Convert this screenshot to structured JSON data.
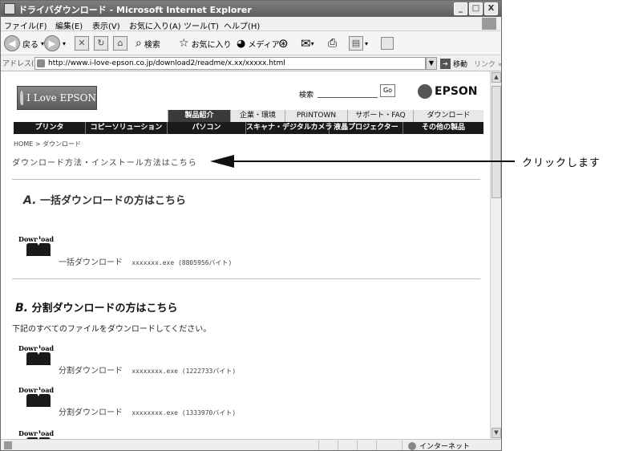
{
  "window": {
    "title": "ドライバダウンロード - Microsoft Internet Explorer",
    "controls": {
      "minimize": "_",
      "maximize": "□",
      "close": "X"
    }
  },
  "menu": [
    "ファイル(F)",
    "編集(E)",
    "表示(V)",
    "お気に入り(A)",
    "ツール(T)",
    "ヘルプ(H)"
  ],
  "toolbar": {
    "back": "戻る",
    "search": "検索",
    "favorites": "お気に入り",
    "media": "メディア"
  },
  "address": {
    "label": "アドレス(D)",
    "url": "http://www.i-love-epson.co.jp/download2/readme/x.xx/xxxxx.html",
    "go": "移動",
    "links": "リンク »"
  },
  "site": {
    "logo": "I Love EPSON",
    "search_label": "検索",
    "search_go": "Go",
    "brand": "EPSON",
    "nav_top": [
      "製品紹介",
      "企業・環境",
      "PRINTOWN",
      "サポート・FAQ",
      "ダウンロード"
    ],
    "nav_bottom": [
      "プリンタ",
      "コピーソリューション",
      "パソコン",
      "スキャナ・デジタルカメラ",
      "液晶プロジェクター",
      "その他の製品"
    ],
    "breadcrumb": "HOME > ダウンロード",
    "howto_link": "ダウンロード方法・インストール方法はこちら"
  },
  "section_a": {
    "letter": "A.",
    "title": "一括ダウンロードの方はこちら",
    "downloads": [
      {
        "icon_text": "Download",
        "label": "一括ダウンロード",
        "file": "xxxxxxx.exe (8805956バイト)"
      }
    ]
  },
  "section_b": {
    "letter": "B.",
    "title": "分割ダウンロードの方はこちら",
    "note": "下記のすべてのファイルをダウンロードしてください。",
    "downloads": [
      {
        "icon_text": "Download",
        "label": "分割ダウンロード",
        "file": "xxxxxxxx.exe (1222733バイト)"
      },
      {
        "icon_text": "Download",
        "label": "分割ダウンロード",
        "file": "xxxxxxxx.exe (1333970バイト)"
      },
      {
        "icon_text": "Download"
      }
    ]
  },
  "status": {
    "zone": "インターネット"
  },
  "annotation": {
    "label": "クリックします"
  }
}
